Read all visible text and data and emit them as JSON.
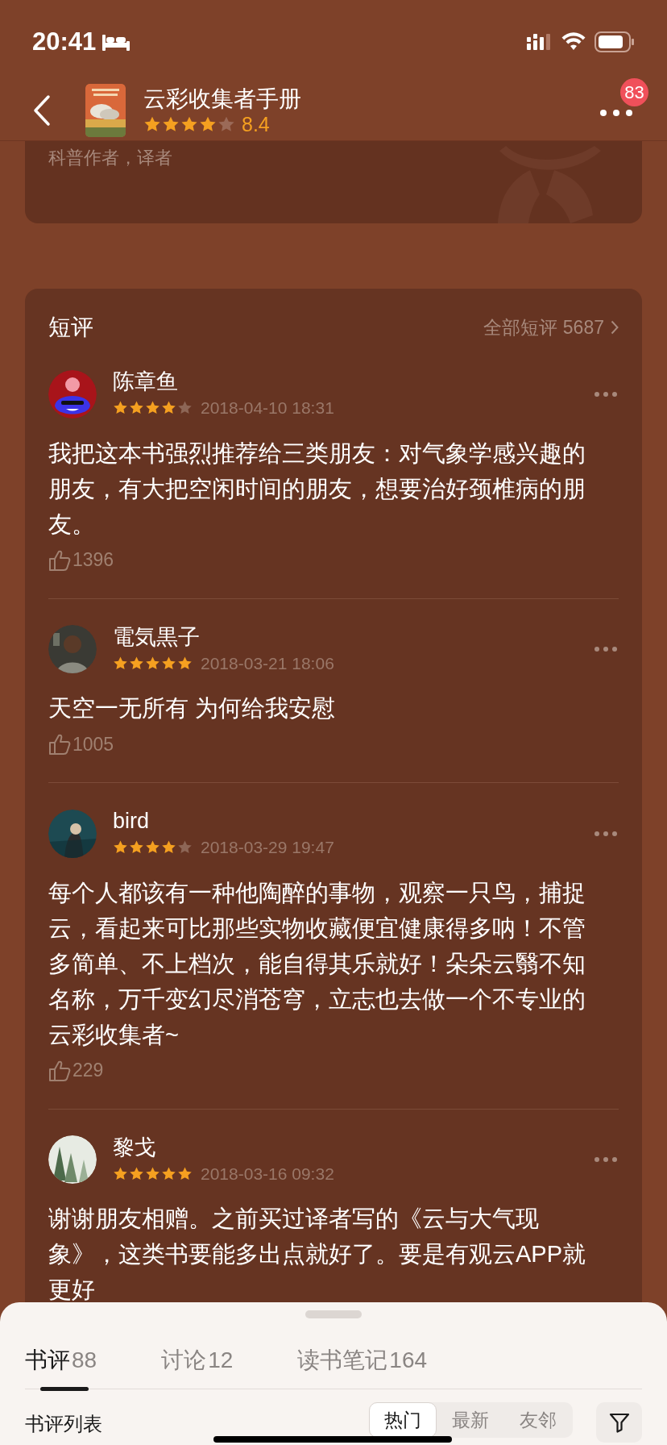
{
  "status_bar": {
    "time": "20:41"
  },
  "header": {
    "title": "云彩收集者手册",
    "stars": 4,
    "rating": "8.4",
    "badge": "83"
  },
  "author_card": {
    "subtitle": "科普作者，译者"
  },
  "short_reviews": {
    "title": "短评",
    "all_link": "全部短评 5687",
    "reviews": [
      {
        "name": "陈章鱼",
        "stars": 4,
        "date": "2018-04-10 18:31",
        "text": "我把这本书强烈推荐给三类朋友：对气象学感兴趣的朋友，有大把空闲时间的朋友，想要治好颈椎病的朋友。",
        "likes": "1396"
      },
      {
        "name": "電気黒子",
        "stars": 5,
        "date": "2018-03-21 18:06",
        "text": "天空一无所有 为何给我安慰",
        "likes": "1005"
      },
      {
        "name": "bird",
        "stars": 4,
        "date": "2018-03-29 19:47",
        "text": "每个人都该有一种他陶醉的事物，观察一只鸟，捕捉云，看起来可比那些实物收藏便宜健康得多呐！不管多简单、不上档次，能自得其乐就好！朵朵云翳不知名称，万千变幻尽消苍穹，立志也去做一个不专业的云彩收集者~",
        "likes": "229"
      },
      {
        "name": "黎戈",
        "stars": 5,
        "date": "2018-03-16 09:32",
        "text": "谢谢朋友相赠。之前买过译者写的《云与大气现象》，这类书要能多出点就好了。要是有观云APP就更好"
      }
    ]
  },
  "sheet": {
    "tabs": [
      {
        "label": "书评",
        "count": "88",
        "selected": true
      },
      {
        "label": "讨论",
        "count": "12",
        "selected": false
      },
      {
        "label": "读书笔记",
        "count": "164",
        "selected": false
      }
    ],
    "list_title": "书评列表",
    "sort_options": [
      {
        "label": "热门",
        "selected": true
      },
      {
        "label": "最新",
        "selected": false
      },
      {
        "label": "友邻",
        "selected": false
      }
    ]
  }
}
